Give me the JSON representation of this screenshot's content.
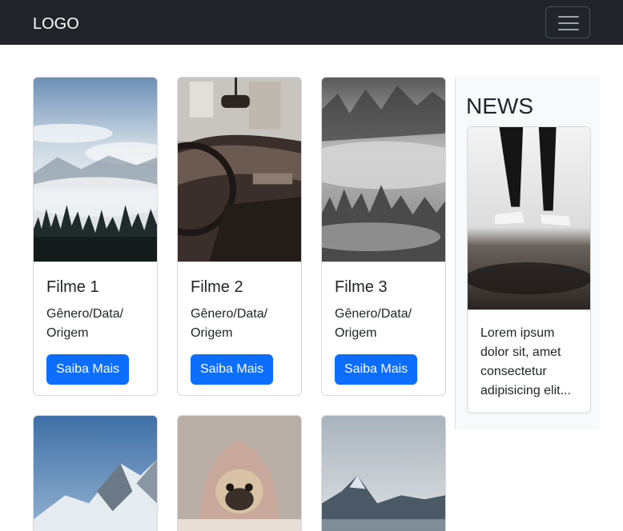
{
  "navbar": {
    "logo": "LOGO",
    "toggler_icon": "hamburger-menu-icon"
  },
  "movies": [
    {
      "title": "Filme 1",
      "meta": "Gênero/Data/ Origem",
      "button": "Saiba Mais",
      "image": "misty-mountain-forest"
    },
    {
      "title": "Filme 2",
      "meta": "Gênero/Data/ Origem",
      "button": "Saiba Mais",
      "image": "vintage-car-interior"
    },
    {
      "title": "Filme 3",
      "meta": "Gênero/Data/ Origem",
      "button": "Saiba Mais",
      "image": "foggy-forest-bw"
    },
    {
      "image": "snowy-mountain-peaks"
    },
    {
      "image": "pug-in-blanket"
    },
    {
      "image": "mountain-lake-valley"
    }
  ],
  "news": {
    "heading": "NEWS",
    "image": "person-legs-sneakers",
    "text": "Lorem ipsum dolor sit, amet consectetur adipisicing elit..."
  },
  "colors": {
    "navbar_bg": "#212529",
    "primary_button": "#0d6efd",
    "aside_bg": "#f8f9fa"
  }
}
